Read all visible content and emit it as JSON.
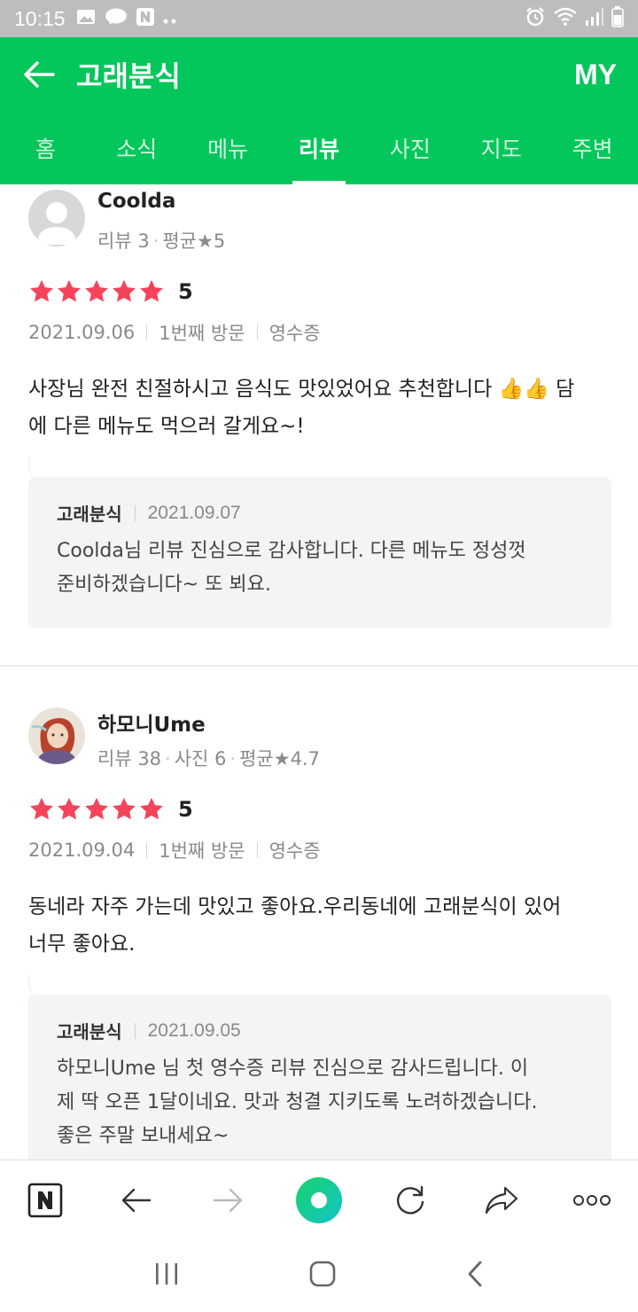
{
  "status_bar": {
    "time": "10:15"
  },
  "header": {
    "title": "고래분식",
    "my_label": "MY"
  },
  "tabs": [
    {
      "label": "홈"
    },
    {
      "label": "소식"
    },
    {
      "label": "메뉴"
    },
    {
      "label": "리뷰",
      "active": true
    },
    {
      "label": "사진"
    },
    {
      "label": "지도"
    },
    {
      "label": "주변"
    }
  ],
  "reviews": [
    {
      "nickname": "Coolda",
      "stats": [
        "리뷰 3",
        "평균★5"
      ],
      "rating": 5,
      "score_label": "5",
      "date": "2021.09.06",
      "visit": "1번째 방문",
      "verify": "영수증",
      "text_line1": "사장님 완전 친절하시고 음식도 맛있었어요 추천합니다 👍👍 담",
      "text_line2": "에 다른 메뉴도 먹으러 갈게요~!",
      "reply": {
        "owner": "고래분식",
        "date": "2021.09.07",
        "line1": "Coolda님 리뷰 진심으로 감사합니다. 다른 메뉴도 정성껏",
        "line2": "준비하겠습니다~ 또 뵈요."
      }
    },
    {
      "nickname": "하모니Ume",
      "stats": [
        "리뷰 38",
        "사진 6",
        "평균★4.7"
      ],
      "rating": 5,
      "score_label": "5",
      "date": "2021.09.04",
      "visit": "1번째 방문",
      "verify": "영수증",
      "text_line1": "동네라 자주 가는데 맛있고 좋아요.우리동네에 고래분식이 있어",
      "text_line2": "너무 좋아요.",
      "reply": {
        "owner": "고래분식",
        "date": "2021.09.05",
        "line1": "하모니Ume 님 첫 영수증 리뷰 진심으로 감사드립니다. 이",
        "line2": "제 딱 오픈 1달이네요. 맛과 청결 지키도록 노려하겠습니다.",
        "line3": "좋은 주말 보내세요~"
      }
    }
  ],
  "colors": {
    "brand_green": "#03c75a",
    "star_red": "#f5445a"
  },
  "browser_bar_icons": [
    "naver-n-icon",
    "back-arrow-icon",
    "forward-arrow-icon",
    "green-dot-icon",
    "refresh-icon",
    "share-icon",
    "more-icon"
  ],
  "nav_icons": [
    "recent-apps-icon",
    "home-icon",
    "back-icon"
  ]
}
